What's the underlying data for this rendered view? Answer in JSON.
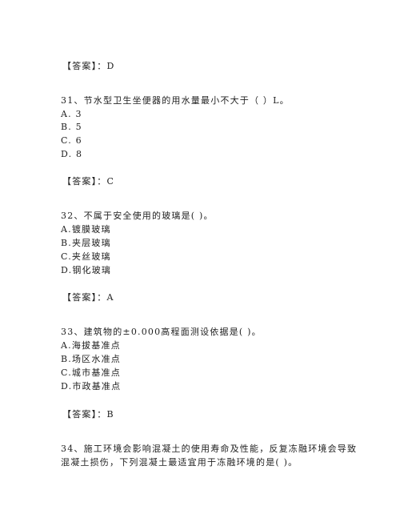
{
  "blocks": [
    {
      "type": "answer",
      "text": "【答案】：D"
    },
    {
      "type": "question",
      "text": "31、节水型卫生坐便器的用水量最小不大于（     ）L。",
      "options": [
        "A. 3",
        "B. 5",
        "C. 6",
        "D. 8"
      ]
    },
    {
      "type": "answer",
      "text": "【答案】：C"
    },
    {
      "type": "question",
      "text": "32、不属于安全使用的玻璃是(      )。",
      "options": [
        "A.镀膜玻璃",
        "B.夹层玻璃",
        "C.夹丝玻璃",
        "D.钢化玻璃"
      ]
    },
    {
      "type": "answer",
      "text": "【答案】：A"
    },
    {
      "type": "question",
      "text": "33、建筑物的±0.000高程面测设依据是(      )。",
      "options": [
        "A.海拔基准点",
        "B.场区水准点",
        "C.城市基准点",
        "D.市政基准点"
      ]
    },
    {
      "type": "answer",
      "text": "【答案】：B"
    },
    {
      "type": "question",
      "lines": [
        "34、施工环境会影响混凝土的使用寿命及性能，反复冻融环境会导致",
        "混凝土损伤，下列混凝土最适宜用于冻融环境的是(      )。"
      ]
    }
  ]
}
